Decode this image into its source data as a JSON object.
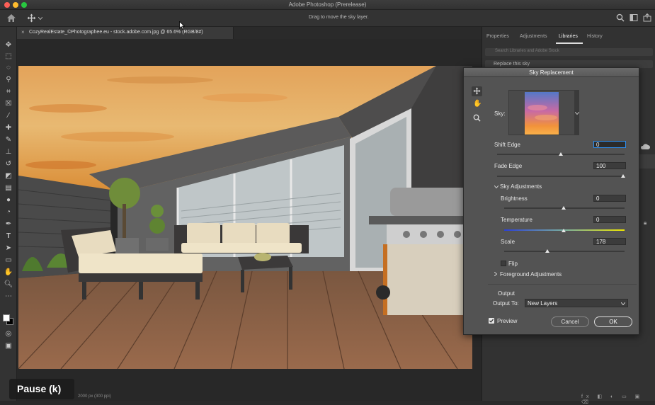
{
  "window": {
    "title": "Adobe Photoshop (Prerelease)",
    "hint": "Drag to move the sky layer."
  },
  "document": {
    "tab_title": "CozyRealEstate_©Photographee.eu - stock.adobe.com.jpg @ 65.6% (RGB/8#)",
    "status": "2000 px (300 ppi)"
  },
  "panels": {
    "tabs": [
      "Properties",
      "Adjustments",
      "Libraries",
      "History"
    ],
    "search_placeholder": "Search Libraries and Adobe Stock",
    "dropdown": "Replace this sky"
  },
  "dialog": {
    "title": "Sky Replacement",
    "sky_label": "Sky:",
    "shift_edge": {
      "label": "Shift Edge",
      "value": "0"
    },
    "fade_edge": {
      "label": "Fade Edge",
      "value": "100"
    },
    "sky_adjustments": "Sky Adjustments",
    "brightness": {
      "label": "Brightness",
      "value": "0"
    },
    "temperature": {
      "label": "Temperature",
      "value": "0"
    },
    "scale": {
      "label": "Scale",
      "value": "178"
    },
    "flip": "Flip",
    "foreground_adjustments": "Foreground Adjustments",
    "output_section": "Output",
    "output_to_label": "Output To:",
    "output_to_value": "New Layers",
    "preview": "Preview",
    "cancel": "Cancel",
    "ok": "OK"
  },
  "overlay": {
    "pause": "Pause (k)"
  },
  "colors": {
    "accent": "#2d8ceb",
    "dialog_bg": "#535353",
    "panel_bg": "#323232"
  }
}
